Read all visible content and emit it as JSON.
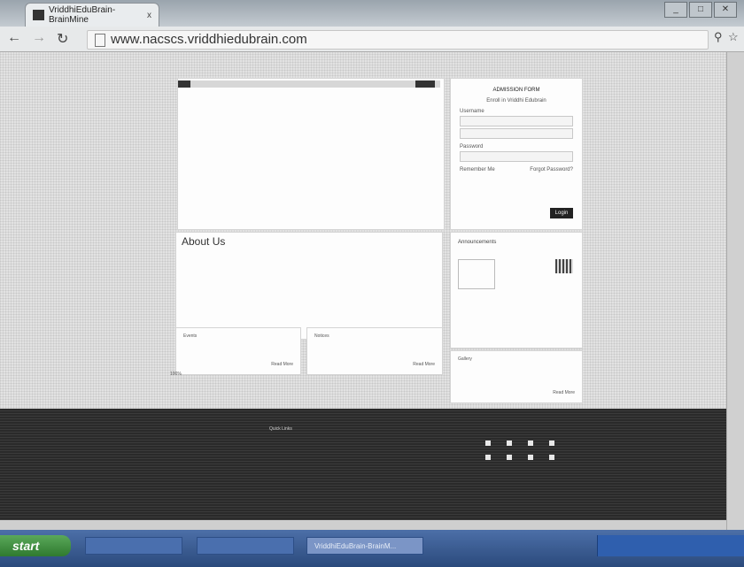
{
  "browser": {
    "tab_title": "VriddhiEduBrain-BrainMine ",
    "tab_close": "x",
    "url": "www.nacscs.vriddhiedubrain.com",
    "window_buttons": [
      "_",
      "□",
      "✕"
    ]
  },
  "login": {
    "title": "ADMISSION FORM",
    "subtitle": "Enroll in Vriddhi Edubrain",
    "username_label": "Username",
    "username_value": "",
    "password_label": "Password",
    "remember": "Remember Me",
    "forgot": "Forgot Password?",
    "submit": "Login"
  },
  "about": {
    "title": "About Us",
    "text": ""
  },
  "announcements": {
    "title": "Announcements"
  },
  "sections": {
    "events_title": "Events",
    "events_more": "Read More",
    "notices_title": "Notices",
    "notices_more": "Read More",
    "gallery_title": "Gallery",
    "gallery_more": "Read More",
    "percent": "100%"
  },
  "footer": {
    "col1_title": "",
    "col2_title": "Quick Links",
    "copyright": ""
  },
  "taskbar": {
    "start": "start",
    "buttons": [
      "",
      "",
      "VriddhiEduBrain-BrainM..."
    ],
    "tray": ""
  }
}
